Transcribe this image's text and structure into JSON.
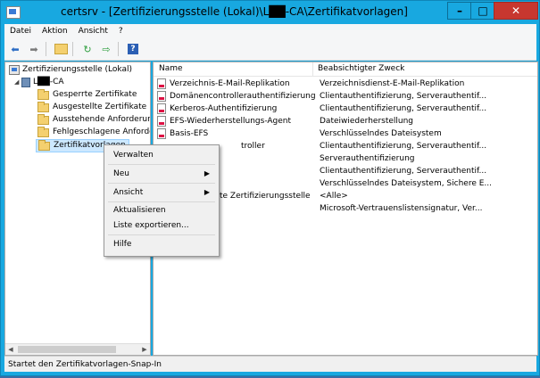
{
  "window": {
    "title": "certsrv - [Zertifizierungsstelle (Lokal)\\L██-CA\\Zertifikatvorlagen]"
  },
  "menu": [
    "Datei",
    "Aktion",
    "Ansicht",
    "?"
  ],
  "tree": {
    "root": "Zertifizierungsstelle (Lokal)",
    "ca": "L██-CA",
    "folders": [
      "Gesperrte Zertifikate",
      "Ausgestellte Zertifikate",
      "Ausstehende Anforderung",
      "Fehlgeschlagene Anforder",
      "Zertifikatvorlagen"
    ]
  },
  "list": {
    "headers": [
      "Name",
      "Beabsichtigter Zweck"
    ],
    "rows": [
      {
        "name": "Verzeichnis-E-Mail-Replikation",
        "purpose": "Verzeichnisdienst-E-Mail-Replikation"
      },
      {
        "name": "Domänencontrollerauthentifizierung",
        "purpose": "Clientauthentifizierung, Serverauthentif..."
      },
      {
        "name": "Kerberos-Authentifizierung",
        "purpose": "Clientauthentifizierung, Serverauthentif..."
      },
      {
        "name": "EFS-Wiederherstellungs-Agent",
        "purpose": "Dateiwiederherstellung"
      },
      {
        "name": "Basis-EFS",
        "purpose": "Verschlüsselndes Dateisystem"
      },
      {
        "name": "troller",
        "purpose": "Clientauthentifizierung, Serverauthentif..."
      },
      {
        "name": "",
        "purpose": "Serverauthentifizierung"
      },
      {
        "name": "",
        "purpose": "Clientauthentifizierung, Serverauthentif..."
      },
      {
        "name": "",
        "purpose": "Verschlüsselndes Dateisystem, Sichere E..."
      },
      {
        "name": "te Zertifizierungsstelle",
        "purpose": "<Alle>"
      },
      {
        "name": "",
        "purpose": "Microsoft-Vertrauenslistensignatur, Ver..."
      }
    ]
  },
  "context_menu": {
    "items": [
      "Verwalten",
      "Neu",
      "Ansicht",
      "Aktualisieren",
      "Liste exportieren...",
      "Hilfe"
    ]
  },
  "status": "Startet den Zertifikatvorlagen-Snap-In"
}
